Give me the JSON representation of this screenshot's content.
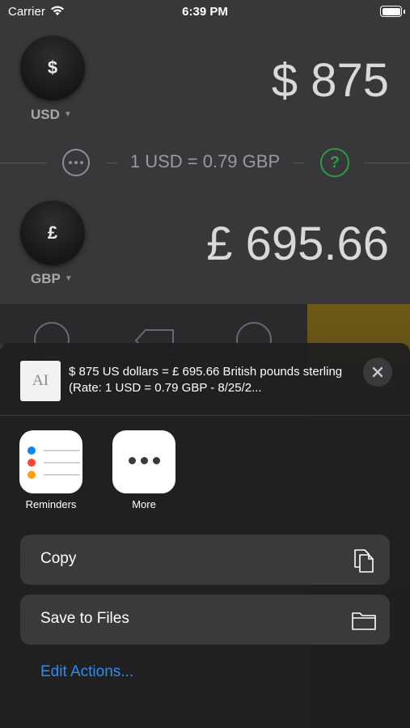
{
  "status_bar": {
    "carrier": "Carrier",
    "time": "6:39 PM"
  },
  "converter": {
    "from": {
      "symbol": "$",
      "code": "USD",
      "amount": "$ 875"
    },
    "to": {
      "symbol": "£",
      "code": "GBP",
      "amount": "£ 695.66"
    },
    "rate": "1 USD = 0.79 GBP",
    "help_symbol": "?"
  },
  "share_sheet": {
    "preview_text": "$ 875 US dollars = £ 695.66 British pounds sterling (Rate: 1 USD = 0.79 GBP - 8/25/2...",
    "thumbnail_glyph": "AI",
    "apps": [
      {
        "label": "Reminders",
        "icon": "reminders-icon"
      },
      {
        "label": "More",
        "icon": "more-icon"
      }
    ],
    "actions": [
      {
        "label": "Copy",
        "icon": "copy-icon"
      },
      {
        "label": "Save to Files",
        "icon": "folder-icon"
      }
    ],
    "edit_actions": "Edit Actions..."
  },
  "colors": {
    "accent_blue": "#2a8cf5",
    "help_green": "#2f9a44",
    "reminder_blue": "#0a84ff",
    "reminder_red": "#ff453a",
    "reminder_orange": "#ff9f0a"
  }
}
